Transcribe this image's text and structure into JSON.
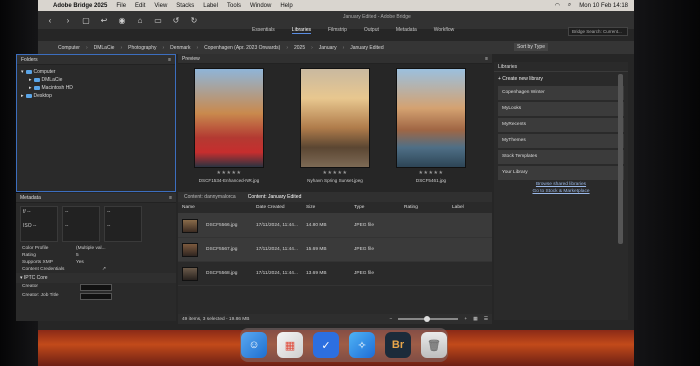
{
  "menubar": {
    "app_name": "Adobe Bridge 2025",
    "items": [
      "File",
      "Edit",
      "View",
      "Stacks",
      "Label",
      "Tools",
      "Window",
      "Help"
    ],
    "clock": "Mon 10 Feb 14:18"
  },
  "window_title": "January Edited - Adobe Bridge",
  "workspaces": [
    "Essentials",
    "Libraries",
    "Filmstrip",
    "Output",
    "Metadata",
    "Workflow"
  ],
  "search_placeholder": "Bridge Search: Current...",
  "path": [
    "Computer",
    "DMLaCie",
    "Photography",
    "Denmark",
    "Copenhagen (Apr. 2023 Onwards)",
    "2025",
    "January",
    "January Edited"
  ],
  "sort_label": "Sort by Type",
  "folders": {
    "title": "Folders",
    "items": [
      "Computer",
      "DMLaCie",
      "Macintosh HD",
      "Desktop"
    ]
  },
  "metadata": {
    "title": "Metadata",
    "box1": [
      "f/ --",
      "--"
    ],
    "box2": [
      "--",
      "--"
    ],
    "box3": [
      "ISO --",
      ""
    ],
    "rows": [
      {
        "k": "Color Profile",
        "v": "(Multiple val..."
      },
      {
        "k": "Rating",
        "v": "5"
      },
      {
        "k": "Supports XMP",
        "v": "Yes"
      },
      {
        "k": "Content Credentials",
        "v": ""
      }
    ],
    "section": "IPTC Core",
    "fields": [
      "Creator",
      "Creator: Job Title"
    ]
  },
  "preview": {
    "title": "Preview",
    "images": [
      {
        "caption": "DSCF1534-Enhanced-NR.jpg",
        "stars": "★★★★★"
      },
      {
        "caption": "Nyhavn Spring Sunset.jpeg",
        "stars": "★★★★★"
      },
      {
        "caption": "DSCF5461.jpg",
        "stars": "★★★★★"
      }
    ]
  },
  "content": {
    "tabs": [
      "Content: dannymalorca",
      "Content: January Edited"
    ],
    "columns": [
      "Name",
      "Date Created",
      "Size",
      "Type",
      "Rating",
      "Label"
    ],
    "rows": [
      {
        "name": "DSCF5566.jpg",
        "date": "17/11/2024, 11:44...",
        "size": "14.80 MB",
        "type": "JPEG file",
        "rating": ""
      },
      {
        "name": "DSCF5567.jpg",
        "date": "17/11/2024, 11:44...",
        "size": "15.69 MB",
        "type": "JPEG file",
        "rating": ""
      },
      {
        "name": "DSCF5568.jpg",
        "date": "17/11/2024, 11:44...",
        "size": "13.69 MB",
        "type": "JPEG file",
        "rating": ""
      }
    ]
  },
  "status": "49 items, 3 selected - 19.86 MB",
  "libraries": {
    "title": "Libraries",
    "create": "+ Create new library",
    "items": [
      "Copenhagen Winter",
      "MyLooks",
      "MyRecents",
      "MyThemes",
      "Stock Templates",
      "Your Library"
    ],
    "links": [
      "Browse shared libraries",
      "Go to Stock & Marketplace"
    ]
  },
  "dock": [
    "Finder",
    "Launchpad",
    "Tasks",
    "Safari",
    "Br",
    "Trash"
  ]
}
